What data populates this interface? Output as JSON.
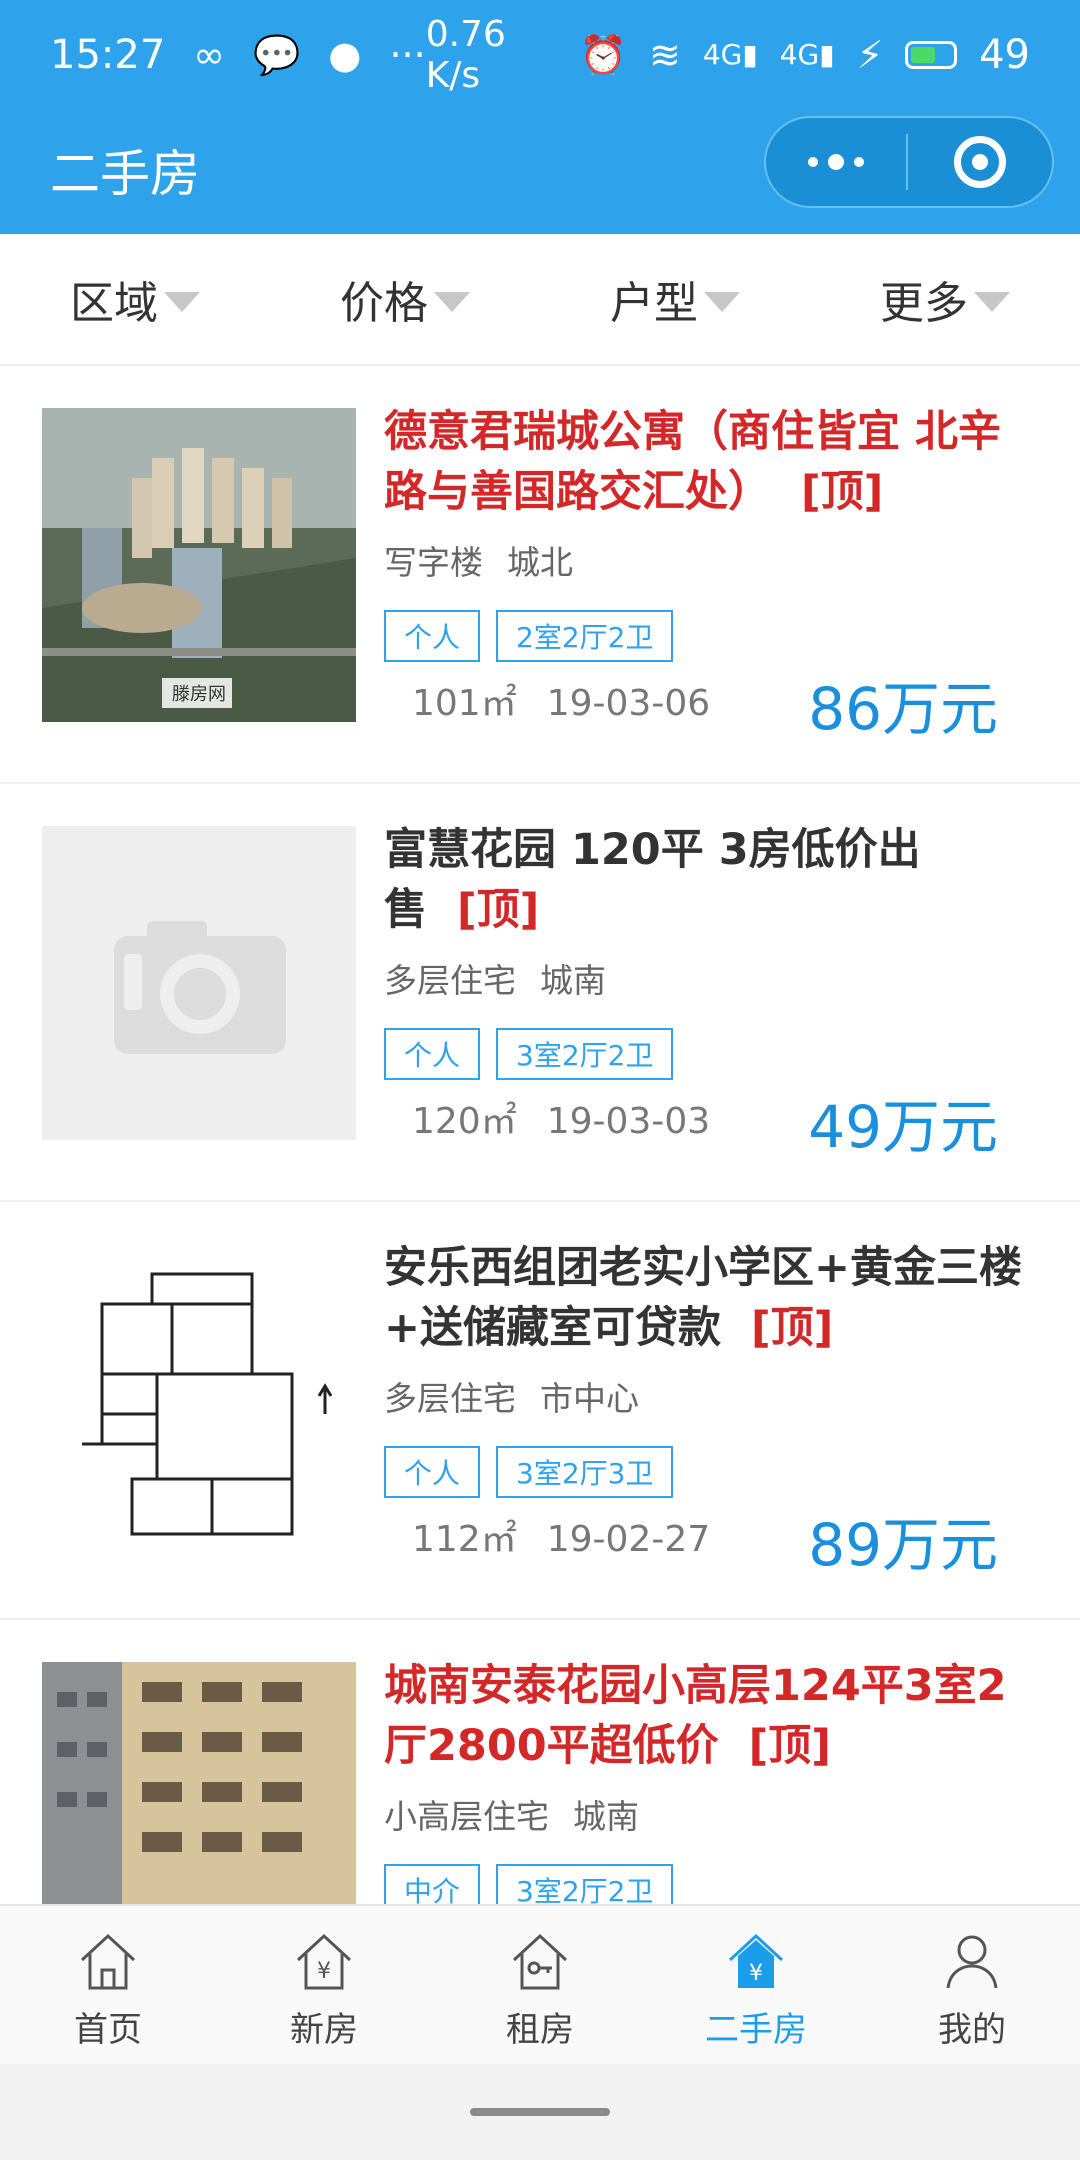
{
  "status_bar": {
    "time": "15:27",
    "speed": "0.76 K/s",
    "battery": "49"
  },
  "header": {
    "title": "二手房"
  },
  "filters": [
    {
      "label": "区域"
    },
    {
      "label": "价格"
    },
    {
      "label": "户型"
    },
    {
      "label": "更多"
    }
  ],
  "listings": [
    {
      "title": "德意君瑞城公寓（商住皆宜 北辛路与善国路交汇处）",
      "top_label": "[顶]",
      "title_color": "#d42828",
      "type": "写字楼",
      "district": "城北",
      "tags": [
        "个人",
        "2室2厅2卫"
      ],
      "area": "101㎡",
      "date": "19-03-06",
      "price": "86万元",
      "image": "aerial-building-photo",
      "watermark": "滕房网"
    },
    {
      "title": "富慧花园 120平 3房低价出售",
      "top_label": "[顶]",
      "title_color": "#333333",
      "type": "多层住宅",
      "district": "城南",
      "tags": [
        "个人",
        "3室2厅2卫"
      ],
      "area": "120㎡",
      "date": "19-03-03",
      "price": "49万元",
      "image": "placeholder-camera"
    },
    {
      "title": "安乐西组团老实小学区+黄金三楼+送储藏室可贷款",
      "top_label": "[顶]",
      "title_color": "#333333",
      "type": "多层住宅",
      "district": "市中心",
      "tags": [
        "个人",
        "3室2厅3卫"
      ],
      "area": "112㎡",
      "date": "19-02-27",
      "price": "89万元",
      "image": "floor-plan"
    },
    {
      "title": "城南安泰花园小高层124平3室2厅2800平超低价",
      "top_label": "[顶]",
      "title_color": "#d42828",
      "type": "小高层住宅",
      "district": "城南",
      "tags": [
        "中介",
        "3室2厅2卫"
      ],
      "area": "",
      "date": "",
      "price": "",
      "image": "building-facade-photo"
    }
  ],
  "tabbar": {
    "items": [
      {
        "label": "首页",
        "icon": "home-icon"
      },
      {
        "label": "新房",
        "icon": "new-house-icon"
      },
      {
        "label": "租房",
        "icon": "rent-house-icon"
      },
      {
        "label": "二手房",
        "icon": "second-hand-house-icon",
        "active": true
      },
      {
        "label": "我的",
        "icon": "profile-icon"
      }
    ]
  },
  "colors": {
    "brand": "#2ea3ec",
    "price": "#1a8fdd",
    "highlight_red": "#d42828"
  }
}
